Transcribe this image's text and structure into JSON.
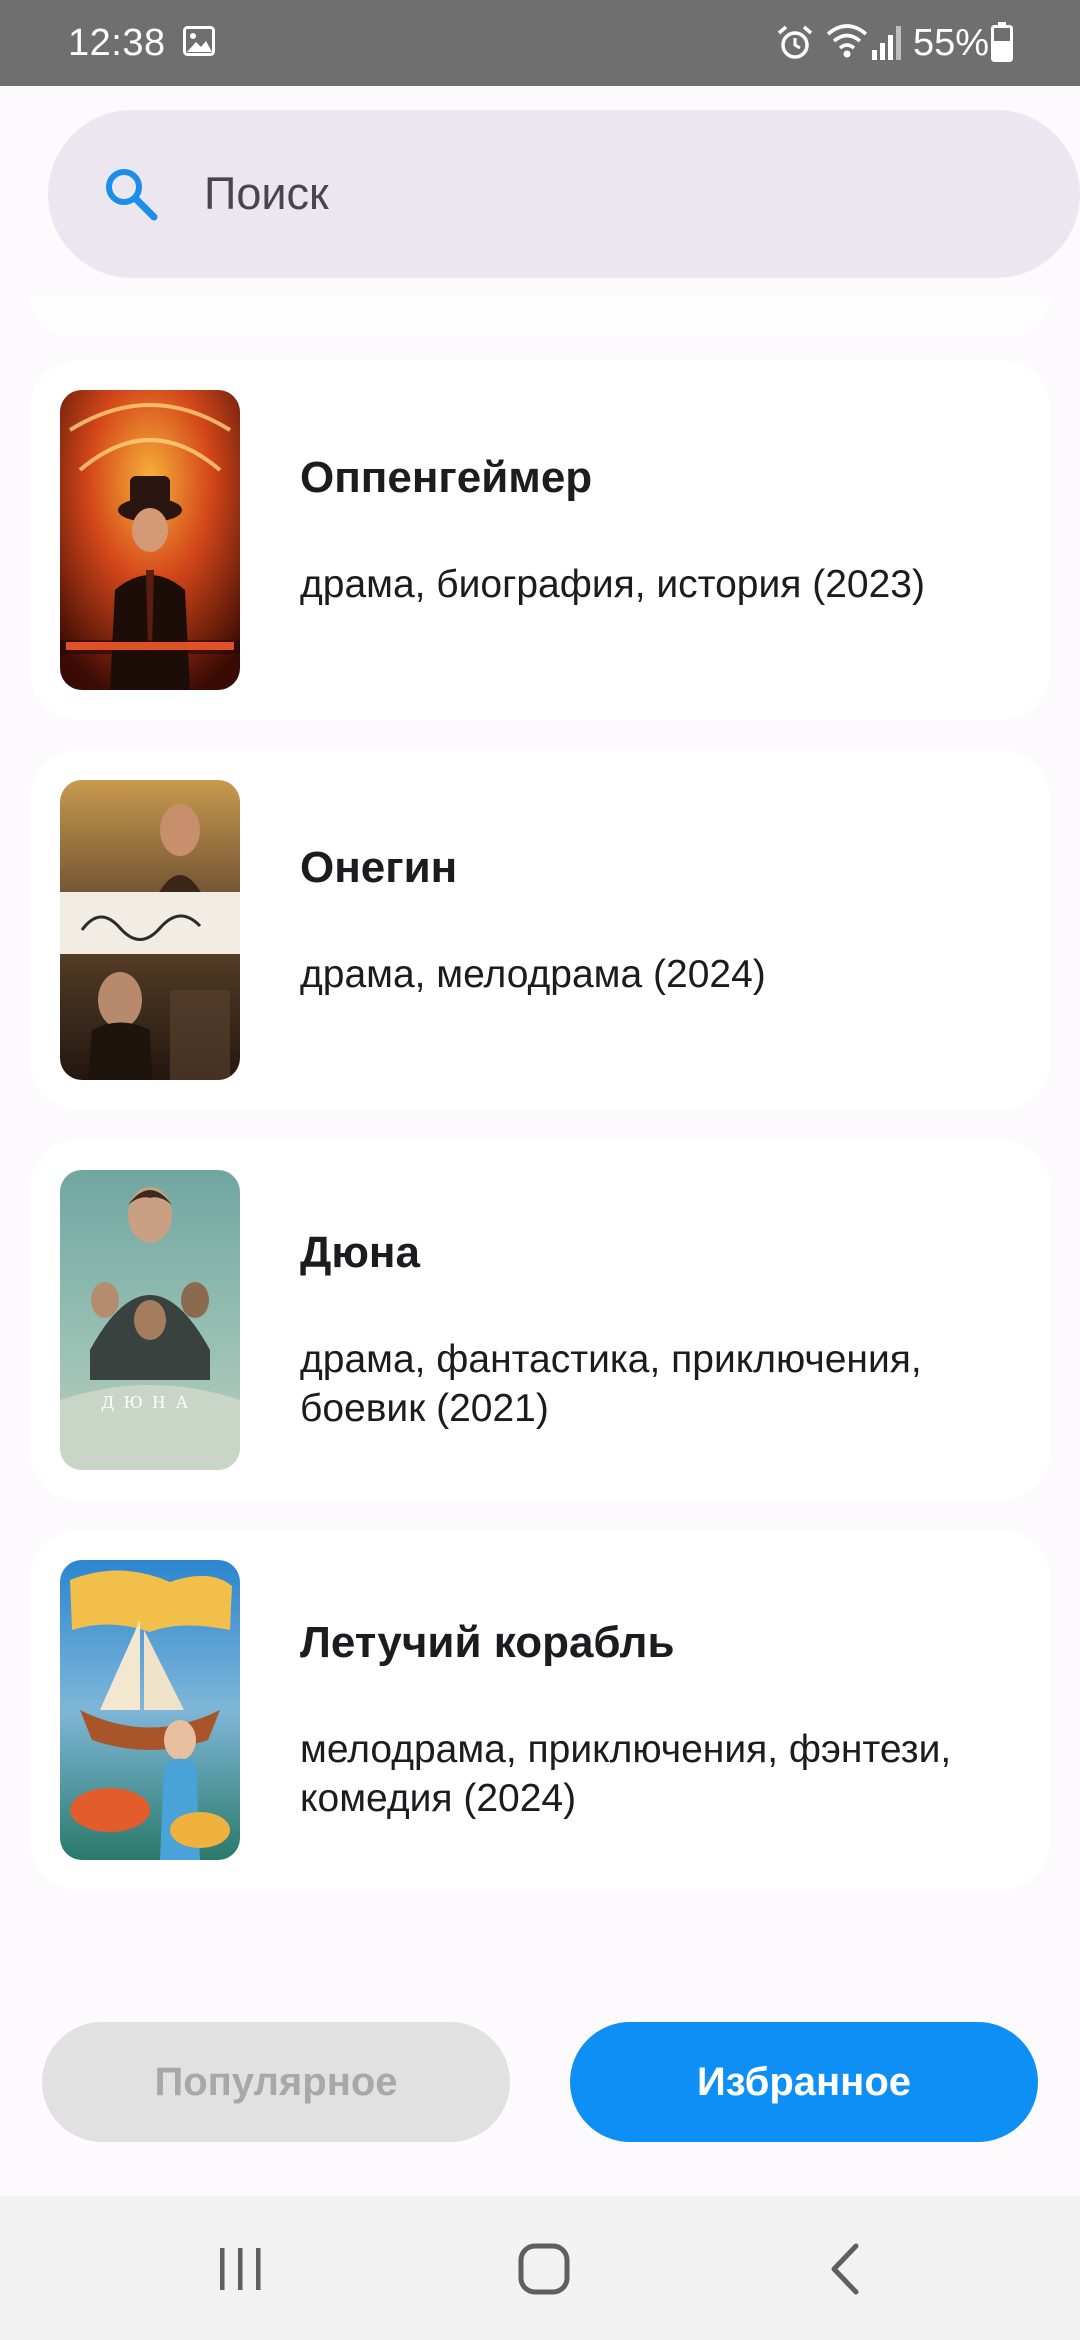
{
  "status_bar": {
    "time": "12:38",
    "battery": "55%",
    "icons": [
      "gallery-icon",
      "alarm-icon",
      "wifi-icon",
      "signal-icon",
      "battery-icon"
    ]
  },
  "search": {
    "placeholder": "Поиск",
    "value": "",
    "icon": "search-icon"
  },
  "movies": [
    {
      "title": "Оппенгеймер",
      "genres": "драма, биография, история (2023)",
      "poster_colors": [
        "#7a1b07",
        "#e8741c"
      ]
    },
    {
      "title": "Онегин",
      "genres": "драма, мелодрама (2024)",
      "poster_colors": [
        "#6b5131",
        "#d9b46a"
      ]
    },
    {
      "title": "Дюна",
      "genres": "драма, фантастика, приключения, боевик (2021)",
      "poster_colors": [
        "#5f9a93",
        "#b6cfc0"
      ]
    },
    {
      "title": "Летучий корабль",
      "genres": "мелодрама, приключения, фэнтези, комедия (2024)",
      "poster_colors": [
        "#2f8fd4",
        "#f2b94b"
      ]
    }
  ],
  "tabs": {
    "popular": "Популярное",
    "favorites": "Избранное",
    "active": "favorites"
  },
  "colors": {
    "accent": "#0d8ff5",
    "search_background": "#ece6f0",
    "inactive_tab": "#e1e1e1",
    "inactive_tab_text": "#a8a8a8",
    "status_bar": "#6f6f6f"
  },
  "nav_bar": {
    "icons": [
      "recents-icon",
      "home-icon",
      "back-icon"
    ]
  }
}
